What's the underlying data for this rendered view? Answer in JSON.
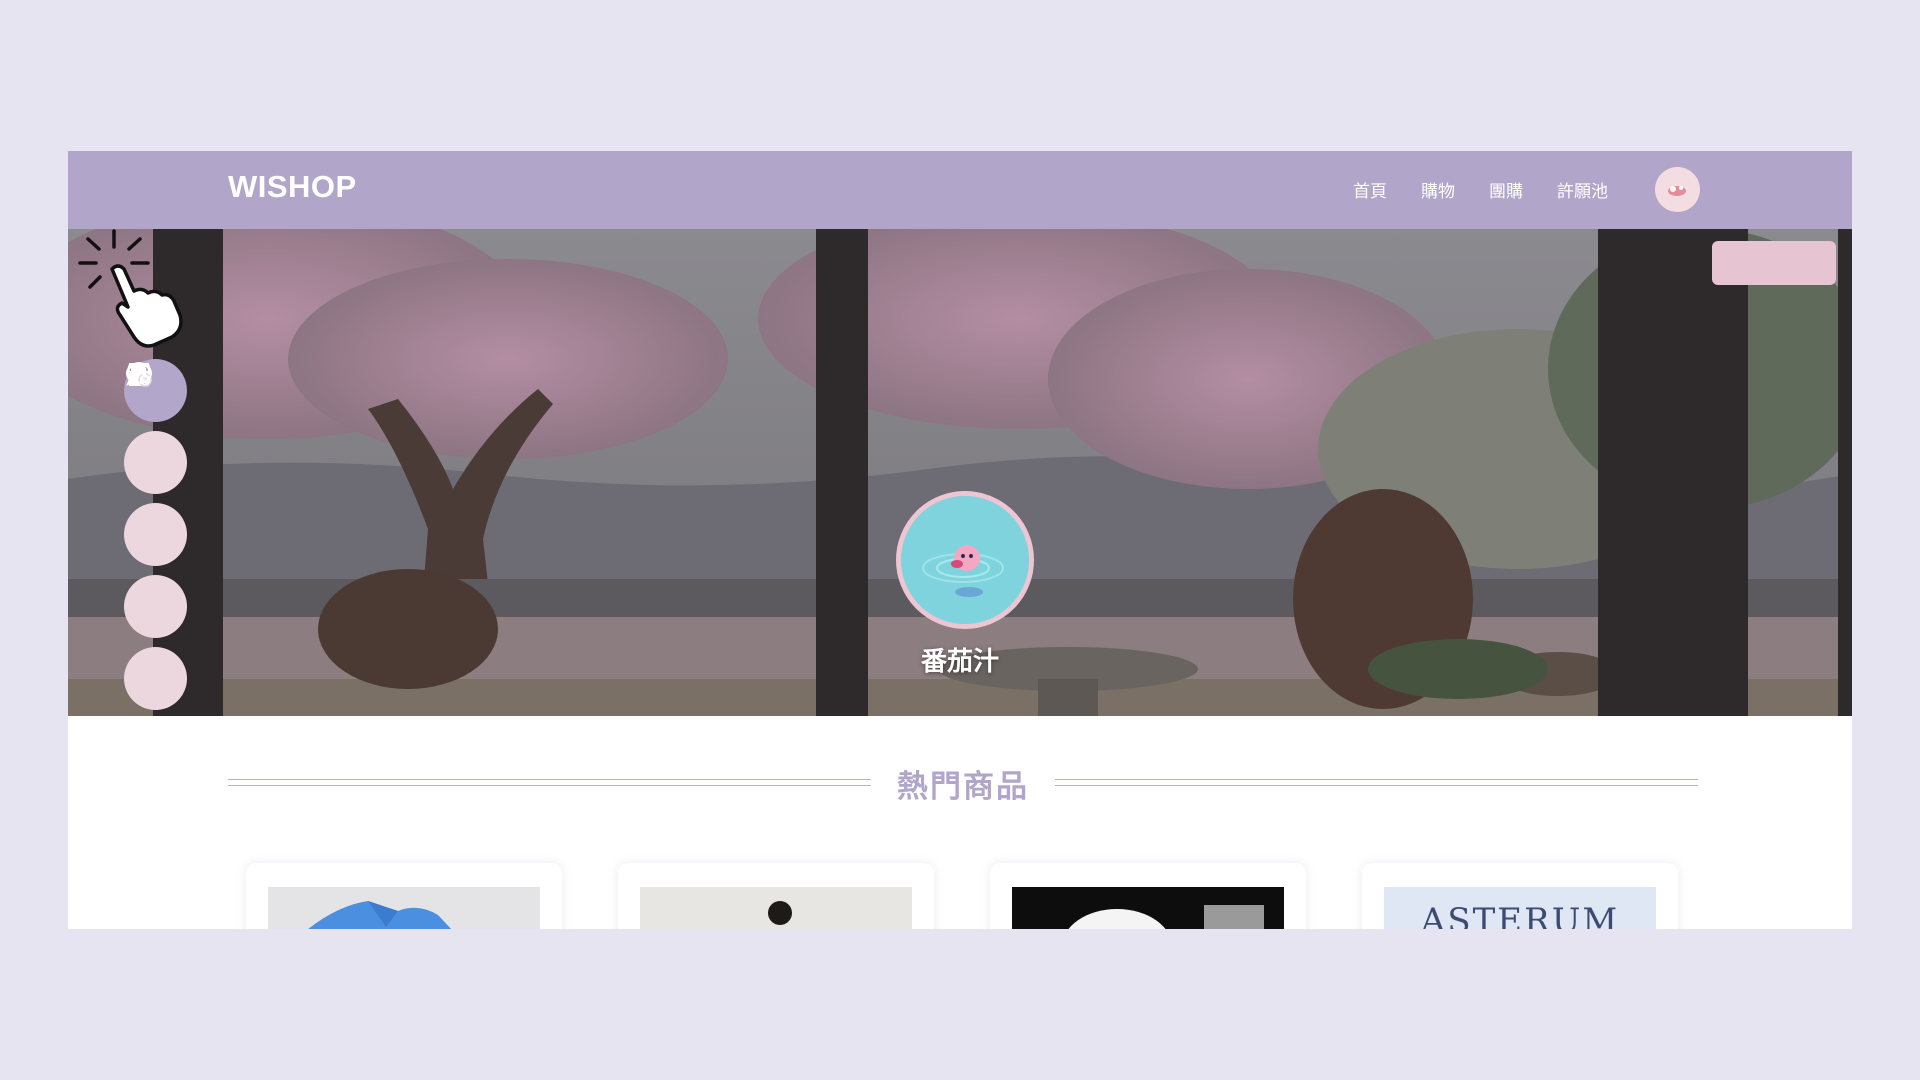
{
  "nav": {
    "logo": "WISHOP",
    "links": [
      "首頁",
      "購物",
      "團購",
      "許願池"
    ]
  },
  "hero": {
    "profile_name": "番茄汁",
    "side_icons": [
      "store-icon",
      "clock-icon",
      "magic-wand-icon",
      "document-help-icon",
      "chat-bubble-icon"
    ]
  },
  "section": {
    "title": "熱門商品"
  },
  "products": [
    {
      "thumb_text": ""
    },
    {
      "thumb_text": ""
    },
    {
      "thumb_text": ""
    },
    {
      "thumb_text": "ASTERUM"
    }
  ],
  "colors": {
    "page_bg": "#e6e4f0",
    "nav_bg": "#b1a5ca",
    "accent_pink": "#ecd7de",
    "accent_purple": "#b3a6cb",
    "title": "#b1a5ca"
  }
}
